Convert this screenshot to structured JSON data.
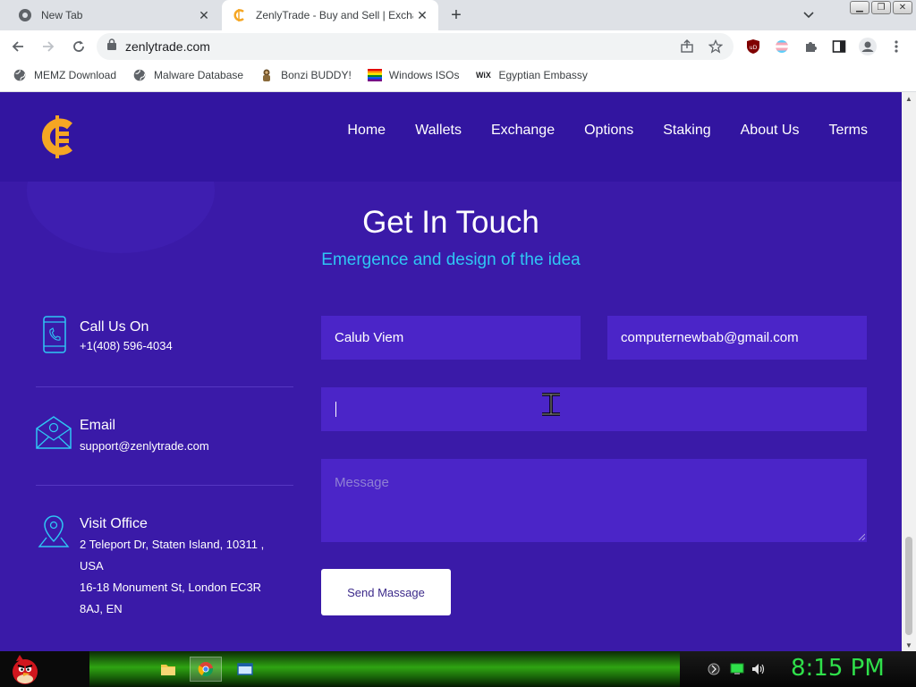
{
  "browser": {
    "tabs": [
      {
        "title": "New Tab",
        "active": false
      },
      {
        "title": "ZenlyTrade - Buy and Sell | Excha",
        "active": true
      }
    ],
    "url": "zenlytrade.com",
    "bookmarks": [
      {
        "label": "MEMZ Download",
        "icon": "globe-icon"
      },
      {
        "label": "Malware Database",
        "icon": "globe-icon"
      },
      {
        "label": "Bonzi BUDDY!",
        "icon": "bonzi-icon"
      },
      {
        "label": "Windows ISOs",
        "icon": "windows-flag-icon"
      },
      {
        "label": "Egyptian Embassy",
        "icon": "wix-icon"
      }
    ],
    "wix_badge": "WiX"
  },
  "site": {
    "nav": [
      "Home",
      "Wallets",
      "Exchange",
      "Options",
      "Staking",
      "About Us",
      "Terms"
    ],
    "heading": "Get In Touch",
    "subheading": "Emergence and design of the idea",
    "contacts": {
      "phone": {
        "title": "Call Us On",
        "lines": [
          "+1(408) 596-4034"
        ]
      },
      "email": {
        "title": "Email",
        "lines": [
          "support@zenlytrade.com"
        ]
      },
      "office": {
        "title": "Visit Office",
        "lines": [
          "2 Teleport Dr, Staten Island, 10311 ,",
          "USA",
          "16-18 Monument St, London EC3R",
          "8AJ, EN"
        ]
      }
    },
    "form": {
      "name_value": "Calub Viem",
      "email_value": "computernewbab@gmail.com",
      "subject_before_caret": "",
      "subject_after_caret": "",
      "message_placeholder": "Message",
      "send_label": "Send Massage"
    },
    "colors": {
      "background": "#3a1aa8",
      "header": "#3215a0",
      "accent": "#2ec7f4",
      "field": "#4b25c8",
      "logo": "#f5a623"
    }
  },
  "taskbar": {
    "clock": "8:15 PM"
  }
}
